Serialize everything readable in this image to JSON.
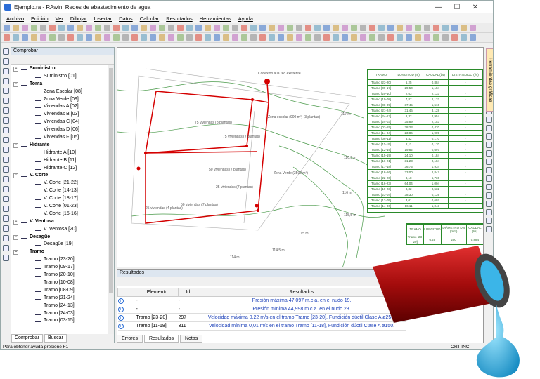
{
  "window": {
    "title": "Ejemplo.ra - RAwin: Redes de abastecimiento de agua",
    "min": "—",
    "max": "☐",
    "close": "✕"
  },
  "menu": [
    "Archivo",
    "Edición",
    "Ver",
    "Dibujar",
    "Insertar",
    "Datos",
    "Calcular",
    "Resultados",
    "Herramientas",
    "Ayuda"
  ],
  "left_panel": {
    "title": "Comprobar",
    "tree": [
      {
        "label": "Suministro",
        "cat": true
      },
      {
        "label": "Suministro [01]"
      },
      {
        "label": "Toma",
        "cat": true
      },
      {
        "label": "Zona Escolar [08]"
      },
      {
        "label": "Zona Verde [09]"
      },
      {
        "label": "Viviendas A [02]"
      },
      {
        "label": "Viviendas B [03]"
      },
      {
        "label": "Viviendas C [04]"
      },
      {
        "label": "Viviendas D [06]"
      },
      {
        "label": "Viviendas F [05]"
      },
      {
        "label": "Hidrante",
        "cat": true
      },
      {
        "label": "Hidrante A [10]"
      },
      {
        "label": "Hidrante B [11]"
      },
      {
        "label": "Hidrante C [12]"
      },
      {
        "label": "V. Corte",
        "cat": true
      },
      {
        "label": "V. Corte [21-22]"
      },
      {
        "label": "V. Corte [14-13]"
      },
      {
        "label": "V. Corte [18-17]"
      },
      {
        "label": "V. Corte [01-23]"
      },
      {
        "label": "V. Corte [15-16]"
      },
      {
        "label": "V. Ventosa",
        "cat": true
      },
      {
        "label": "V. Ventosa [20]"
      },
      {
        "label": "Desagüe",
        "cat": true
      },
      {
        "label": "Desagüe [19]"
      },
      {
        "label": "Tramo",
        "cat": true
      },
      {
        "label": "Tramo [23-20]"
      },
      {
        "label": "Tramo [09-17]"
      },
      {
        "label": "Tramo [20-10]"
      },
      {
        "label": "Tramo [10-08]"
      },
      {
        "label": "Tramo [08-09]"
      },
      {
        "label": "Tramo [21-24]"
      },
      {
        "label": "Tramo [24-13]"
      },
      {
        "label": "Tramo [24-03]"
      },
      {
        "label": "Tramo [03-15]"
      }
    ],
    "tabs": [
      "Comprobar",
      "Buscar"
    ]
  },
  "canvas": {
    "labels": [
      "Conexión a la red existente",
      "Zona escolar (900 m²) (3 plantas)",
      "Zona Verde (3500 m²)",
      "75 viviendas (8 plantas)",
      "75 viviendas (7 plantas)",
      "50 viviendas (7 plantas)",
      "25 viviendas (7 plantas)",
      "25 viviendas (4 plantas)",
      "50 viviendas (7 plantas)",
      "117 m",
      "116,5 m",
      "116 m",
      "115,5 m",
      "115 m",
      "114,5 m",
      "114 m"
    ],
    "table1_headers": [
      "TRAMO",
      "LONGITUD (m)",
      "CAUDAL (l/s)",
      "DISTRIBUIDO (l/s)"
    ],
    "table1_rows": [
      [
        "Tramo [23-20]",
        "6,25",
        "0,884",
        "-"
      ],
      [
        "Tramo [09-17]",
        "29,50",
        "1,184",
        "-"
      ],
      [
        "Tramo [20-10]",
        "2,63",
        "2,133",
        "-"
      ],
      [
        "Tramo [10-08]",
        "7,87",
        "2,133",
        "-"
      ],
      [
        "Tramo [08-09]",
        "37,45",
        "1,510",
        "-"
      ],
      [
        "Tramo [21-24]",
        "31,46",
        "3,128",
        "-"
      ],
      [
        "Tramo [24-13]",
        "8,32",
        "2,954",
        "-"
      ],
      [
        "Tramo [24-03]",
        "35,89",
        "2,153",
        "-"
      ],
      [
        "Tramo [03-15]",
        "38,23",
        "0,470",
        "-"
      ],
      [
        "Tramo [14-04]",
        "23,86",
        "1,909",
        "-"
      ],
      [
        "Tramo [06-11]",
        "6,42",
        "0,170",
        "-"
      ],
      [
        "Tramo [11-19]",
        "2,11",
        "0,170",
        "-"
      ],
      [
        "Tramo [12-19]",
        "19,82",
        "0,697",
        "-"
      ],
      [
        "Tramo [15-19]",
        "24,10",
        "0,184",
        "-"
      ],
      [
        "Tramo [16-21]",
        "31,23",
        "0,184",
        "-"
      ],
      [
        "Tramo [17-18]",
        "36,75",
        "1,934",
        "-"
      ],
      [
        "Tramo [18-16]",
        "33,00",
        "2,847",
        "-"
      ],
      [
        "Tramo [22-20]",
        "8,18",
        "6,736",
        "-"
      ],
      [
        "Tramo [16-23]",
        "64,04",
        "1,004",
        "-"
      ],
      [
        "Tramo [19-23]",
        "8,32",
        "0,532",
        "-"
      ],
      [
        "Tramo [23-04]",
        "38,30",
        "0,139",
        "-"
      ],
      [
        "Tramo [12-05]",
        "3,01",
        "0,697",
        "-"
      ],
      [
        "Tramo [14-06]",
        "16,11",
        "1,043",
        "-"
      ]
    ],
    "table2_headers": [
      "TRAMO",
      "LONGITUD",
      "DIÁMETRO DN (mm)",
      "CAUDAL (l/s)"
    ],
    "table2_rows": [
      [
        "Tramo [23-20]",
        "6,25",
        "250",
        "0,884"
      ]
    ]
  },
  "results": {
    "title": "Resultados",
    "headers": [
      "Elemento",
      "Id",
      "Resultados"
    ],
    "rows": [
      {
        "elem": "-",
        "id": "-",
        "text": "Presión máxima 47,097 m.c.a. en el nudo 19."
      },
      {
        "elem": "-",
        "id": "-",
        "text": "Presión mínima 44,998 m.c.a. en el nudo 23."
      },
      {
        "elem": "Tramo [23-20]",
        "id": "297",
        "text": "Velocidad máxima 0,22 m/s en el tramo Tramo [23-20], Fundición dúctil Clase A ø250."
      },
      {
        "elem": "Tramo [11-18]",
        "id": "311",
        "text": "Velocidad mínima 0,01 m/s en el tramo Tramo [11-18], Fundición dúctil Clase A ø150."
      }
    ],
    "tabs": [
      "Errores",
      "Resultados",
      "Notas"
    ]
  },
  "right_tab": "Herramientas gráficas",
  "status": "Para obtener ayuda presione F1",
  "status_right": "ORT INC"
}
